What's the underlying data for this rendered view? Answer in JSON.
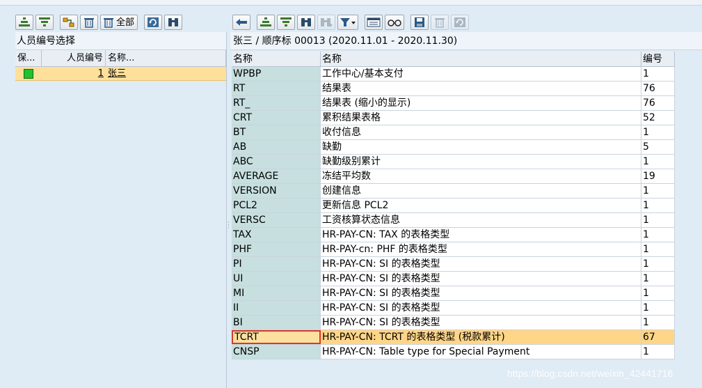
{
  "left_toolbar": {
    "buttons": [
      {
        "icon": "sort-ascending-icon"
      },
      {
        "icon": "filter-icon"
      },
      {
        "icon": "expand-all-icon"
      },
      {
        "icon": "delete-icon"
      },
      {
        "icon": "delete-all-icon",
        "label": "全部"
      },
      {
        "icon": "refresh-icon"
      },
      {
        "icon": "find-icon"
      }
    ]
  },
  "right_toolbar": {
    "buttons": [
      {
        "icon": "back-arrow-icon"
      },
      {
        "icon": "sort-ascending-icon"
      },
      {
        "icon": "filter-icon"
      },
      {
        "icon": "find-icon"
      },
      {
        "icon": "find-next-icon"
      },
      {
        "icon": "set-filter-icon"
      },
      {
        "icon": "details-icon"
      },
      {
        "icon": "display-glasses-icon"
      },
      {
        "icon": "save-icon"
      },
      {
        "icon": "delete-icon"
      },
      {
        "icon": "refresh-icon"
      }
    ]
  },
  "left_panel": {
    "title": "人员编号选择",
    "headers": {
      "save": "保...",
      "number": "人员编号",
      "name": "名称..."
    },
    "rows": [
      {
        "number": "1",
        "name": "张三",
        "status_color": "#22c22c"
      }
    ]
  },
  "right_panel": {
    "title": "张三 / 顺序标 00013 (2020.11.01 - 2020.11.30)",
    "headers": {
      "col1": "名称",
      "col2": "名称",
      "col3": "编号"
    },
    "rows": [
      {
        "name": "WPBP",
        "desc": "工作中心/基本支付",
        "num": "1"
      },
      {
        "name": "RT",
        "desc": "结果表",
        "num": "76"
      },
      {
        "name": "RT_",
        "desc": "结果表 (缩小的显示)",
        "num": "76"
      },
      {
        "name": "CRT",
        "desc": "累积结果表格",
        "num": "52"
      },
      {
        "name": "BT",
        "desc": "收付信息",
        "num": "1"
      },
      {
        "name": "AB",
        "desc": "缺勤",
        "num": "5"
      },
      {
        "name": "ABC",
        "desc": "缺勤级别累计",
        "num": "1"
      },
      {
        "name": "AVERAGE",
        "desc": "冻结平均数",
        "num": "19"
      },
      {
        "name": "VERSION",
        "desc": "创建信息",
        "num": "1"
      },
      {
        "name": "PCL2",
        "desc": "更新信息 PCL2",
        "num": "1"
      },
      {
        "name": "VERSC",
        "desc": "工资核算状态信息",
        "num": "1"
      },
      {
        "name": "TAX",
        "desc": "HR-PAY-CN: TAX 的表格类型",
        "num": "1"
      },
      {
        "name": "PHF",
        "desc": "HR-PAY-cn: PHF 的表格类型",
        "num": "1"
      },
      {
        "name": "PI",
        "desc": "HR-PAY-CN: SI 的表格类型",
        "num": "1"
      },
      {
        "name": "UI",
        "desc": "HR-PAY-CN: SI 的表格类型",
        "num": "1"
      },
      {
        "name": "MI",
        "desc": "HR-PAY-CN: SI 的表格类型",
        "num": "1"
      },
      {
        "name": "II",
        "desc": "HR-PAY-CN: SI 的表格类型",
        "num": "1"
      },
      {
        "name": "BI",
        "desc": "HR-PAY-CN: SI 的表格类型",
        "num": "1"
      },
      {
        "name": "TCRT",
        "desc": "HR-PAY-CN: TCRT 的表格类型 (税款累计)",
        "num": "67",
        "selected": true
      },
      {
        "name": "CNSP",
        "desc": "HR-PAY-CN: Table type for Special Payment",
        "num": "1"
      }
    ]
  },
  "watermark": "https://blog.csdn.net/weixin_42441716"
}
